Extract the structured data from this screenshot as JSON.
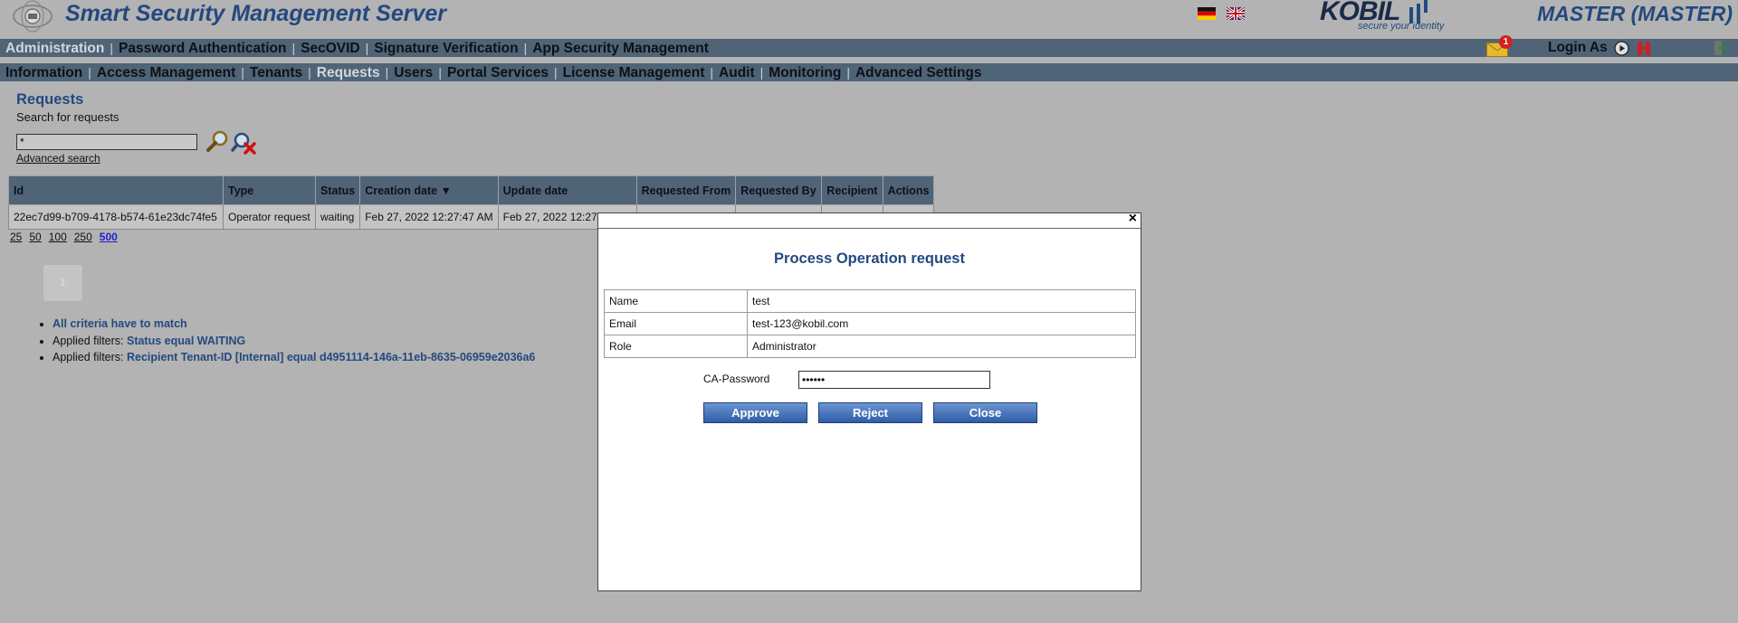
{
  "header": {
    "app_title": "Smart Security Management Server",
    "brand_name": "KOBIL",
    "brand_tagline": "secure your identity",
    "user_title": "MASTER (MASTER)",
    "login_as_label": "Login As",
    "mail_badge_count": "1"
  },
  "nav_primary": [
    "Administration",
    "Password Authentication",
    "SecOVID",
    "Signature Verification",
    "App Security Management"
  ],
  "nav_secondary": [
    "Information",
    "Access Management",
    "Tenants",
    "Requests",
    "Users",
    "Portal Services",
    "License Management",
    "Audit",
    "Monitoring",
    "Advanced Settings"
  ],
  "page": {
    "title": "Requests",
    "subtitle": "Search for requests",
    "search_value": "*",
    "advanced_search_label": "Advanced search",
    "table": {
      "headers": [
        "Id",
        "Type",
        "Status",
        "Creation date ▼",
        "Update date",
        "Requested From",
        "Requested By",
        "Recipient",
        "Actions"
      ],
      "row": [
        "22ec7d99-b709-4178-b574-61e23dc74fe5",
        "Operator request",
        "waiting",
        "Feb 27, 2022 12:27:47 AM",
        "Feb 27, 2022 12:27:47 AM",
        "",
        "",
        "",
        ""
      ]
    },
    "page_sizes": [
      "25",
      "50",
      "100",
      "250",
      "500"
    ],
    "page_button_label": "1",
    "filters": [
      {
        "prefix": "",
        "value": "All criteria have to match"
      },
      {
        "prefix": "Applied filters: ",
        "value": "Status equal WAITING"
      },
      {
        "prefix": "Applied filters: ",
        "value": "Recipient Tenant-ID [Internal] equal d4951114-146a-11eb-8635-06959e2036a6"
      }
    ]
  },
  "modal": {
    "close_glyph": "×",
    "title": "Process Operation request",
    "fields": [
      {
        "label": "Name",
        "value": "test"
      },
      {
        "label": "Email",
        "value": "test-123@kobil.com"
      },
      {
        "label": "Role",
        "value": "Administrator"
      }
    ],
    "password_label": "CA-Password",
    "password_value": "••••••",
    "approve_label": "Approve",
    "reject_label": "Reject",
    "close_label": "Close"
  },
  "colors": {
    "nav_bg": "#506477",
    "brand_blue": "#23497f",
    "page_bg": "#b3b3b3",
    "button_blue": "#2f5da6"
  },
  "icons": [
    "logo-icon",
    "german-flag-icon",
    "english-flag-icon",
    "mail-icon",
    "play-icon",
    "stop-icon",
    "exit-icon",
    "search-icon",
    "clear-search-icon",
    "close-icon"
  ]
}
